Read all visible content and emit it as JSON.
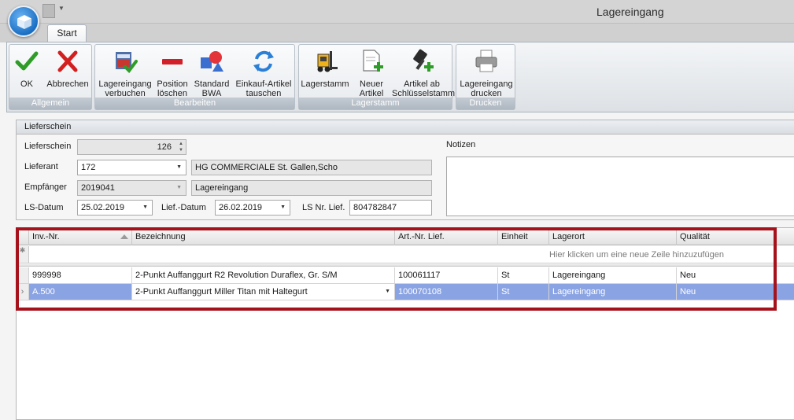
{
  "window": {
    "title": "Lagereingang"
  },
  "ribbon": {
    "tabs": [
      {
        "label": "Start"
      }
    ],
    "groups": {
      "allgemein": {
        "label": "Allgemein",
        "buttons": {
          "ok": "OK",
          "abbrechen": "Abbrechen"
        }
      },
      "bearbeiten": {
        "label": "Bearbeiten",
        "buttons": {
          "verbuchen": "Lagereingang\nverbuchen",
          "position": "Position\nlöschen",
          "bwa": "Standard\nBWA",
          "tauschen": "Einkauf-Artikel\ntauschen"
        }
      },
      "lagerstamm": {
        "label": "Lagerstamm",
        "buttons": {
          "lagerstamm": "Lagerstamm",
          "neuer": "Neuer\nArtikel",
          "schluessel": "Artikel ab\nSchlüsselstamm"
        }
      },
      "drucken": {
        "label": "Drucken",
        "buttons": {
          "drucken": "Lagereingang\ndrucken"
        }
      }
    }
  },
  "lieferschein": {
    "panel_title": "Lieferschein",
    "lieferschein": {
      "label": "Lieferschein",
      "value": "126"
    },
    "lieferant": {
      "label": "Lieferant",
      "value": "172",
      "name": "HG COMMERCIALE St. Gallen,Scho"
    },
    "empfaenger": {
      "label": "Empfänger",
      "value": "2019041",
      "name": "Lagereingang"
    },
    "ls_datum": {
      "label": "LS-Datum",
      "value": "25.02.2019"
    },
    "lief_datum": {
      "label": "Lief.-Datum",
      "value": "26.02.2019"
    },
    "ls_nr": {
      "label": "LS Nr. Lief.",
      "value": "804782847"
    },
    "notizen": {
      "label": "Notizen",
      "value": ""
    }
  },
  "grid": {
    "columns": {
      "inv": "Inv.-Nr.",
      "bez": "Bezeichnung",
      "art": "Art.-Nr. Lief.",
      "einheit": "Einheit",
      "lagerort": "Lagerort",
      "qualitaet": "Qualität"
    },
    "new_row_hint": "Hier klicken um eine neue Zeile hinzuzufügen",
    "rows": [
      {
        "inv": "999998",
        "bez": "2-Punkt Auffanggurt R2 Revolution Duraflex, Gr. S/M",
        "art": "100061117",
        "einheit": "St",
        "lagerort": "Lagereingang",
        "qualitaet": "Neu"
      },
      {
        "inv": "A.500",
        "bez": "2-Punkt Auffanggurt Miller Titan mit Haltegurt",
        "art": "100070108",
        "einheit": "St",
        "lagerort": "Lagereingang",
        "qualitaet": "Neu"
      }
    ]
  },
  "colors": {
    "selection": "#8aa3e3",
    "highlight": "#a5121b",
    "ribbon_label": "#aeb7c1"
  }
}
